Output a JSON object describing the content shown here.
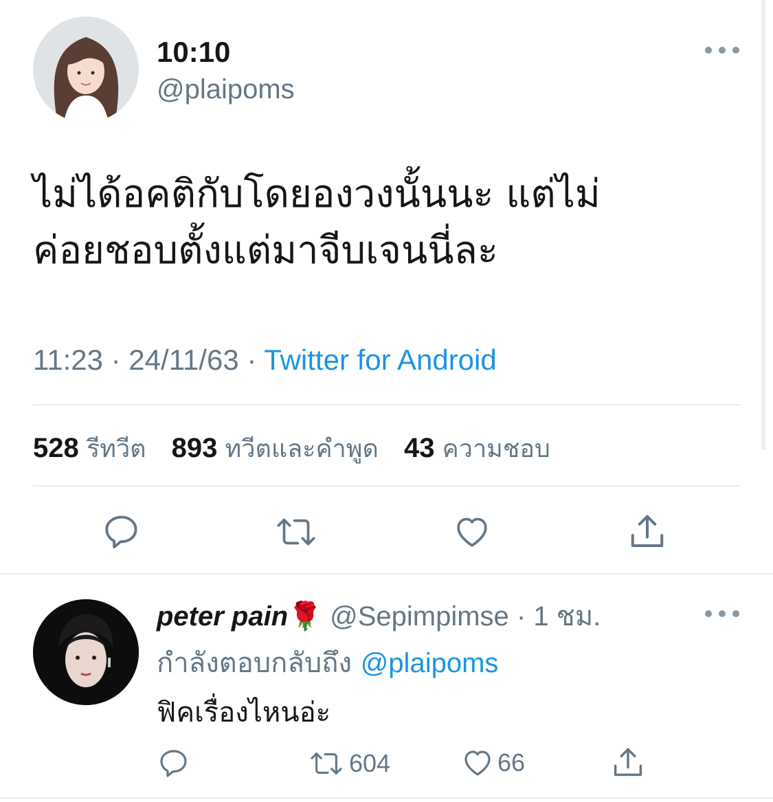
{
  "tweet": {
    "display_name": "10:10",
    "handle": "@plaipoms",
    "text_line1": "ไม่ได้อคติกับโดยองวงนั้นนะ แต่ไม่",
    "text_line2": "ค่อยชอบตั้งแต่มาจีบเจนนี่ละ",
    "time": "11:23 · 24/11/63 · ",
    "source": "Twitter for Android",
    "stats": {
      "retweets_count": "528",
      "retweets_label": "รีทวีต",
      "quotes_count": "893",
      "quotes_label": "ทวีตและคำพูด",
      "likes_count": "43",
      "likes_label": "ความชอบ"
    },
    "icons": {
      "reply": "reply-icon",
      "retweet": "retweet-icon",
      "like": "heart-icon",
      "share": "share-icon",
      "more": "more-icon"
    }
  },
  "reply": {
    "display_name": "peter pain",
    "emoji": "🌹",
    "handle_time": " @Sepimpimse · 1 ชม.",
    "replying_to_label": "กำลังตอบกลับถึง ",
    "replying_to_mention": "@plaipoms",
    "text": "ฟิคเรื่องไหนอ่ะ",
    "retweet_count": "604",
    "like_count": "66"
  },
  "colors": {
    "link": "#1b95e0",
    "secondary_text": "#657786",
    "primary_text": "#14171a",
    "divider": "#e6ecf0"
  }
}
